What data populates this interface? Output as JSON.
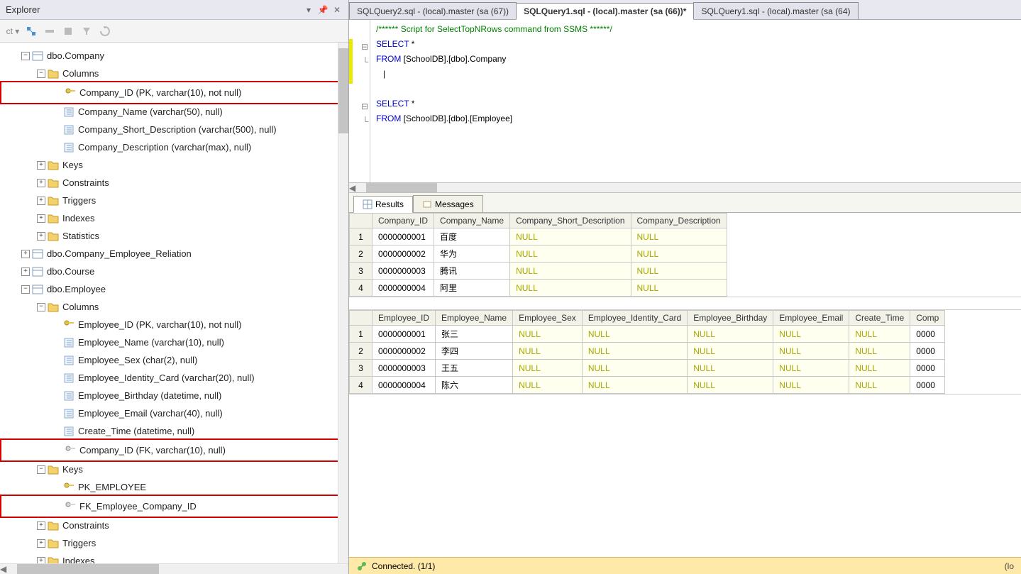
{
  "explorer": {
    "title": "Explorer",
    "tree": {
      "company_table": "dbo.Company",
      "company_columns_folder": "Columns",
      "company_cols": {
        "id": "Company_ID (PK, varchar(10), not null)",
        "name": "Company_Name (varchar(50), null)",
        "short": "Company_Short_Description (varchar(500), null)",
        "desc": "Company_Description (varchar(max), null)"
      },
      "keys": "Keys",
      "constraints": "Constraints",
      "triggers": "Triggers",
      "indexes": "Indexes",
      "statistics": "Statistics",
      "relation": "dbo.Company_Employee_Reliation",
      "course": "dbo.Course",
      "employee_table": "dbo.Employee",
      "employee_columns_folder": "Columns",
      "emp_cols": {
        "id": "Employee_ID (PK, varchar(10), not null)",
        "name": "Employee_Name (varchar(10), null)",
        "sex": "Employee_Sex (char(2), null)",
        "idcard": "Employee_Identity_Card (varchar(20), null)",
        "bday": "Employee_Birthday (datetime, null)",
        "email": "Employee_Email (varchar(40), null)",
        "ctime": "Create_Time (datetime, null)",
        "compid": "Company_ID (FK, varchar(10), null)"
      },
      "emp_keys_folder": "Keys",
      "emp_keys": {
        "pk": "PK_EMPLOYEE",
        "fk": "FK_Employee_Company_ID"
      }
    },
    "toolbar_partial": "ct ▾"
  },
  "tabs": {
    "t1": "SQLQuery2.sql - (local).master (sa (67))",
    "t2": "SQLQuery1.sql - (local).master (sa (66))*",
    "t3": "SQLQuery1.sql - (local).master (sa (64)"
  },
  "sql": {
    "l1_comment": "/****** Script for SelectTopNRows command from SSMS  ******/",
    "l2_select": "SELECT",
    "l2_star": " *",
    "l3_from": "FROM",
    "l3_tbl": " [SchoolDB].[dbo].",
    "l3_tbl2": "Company",
    "l6_select": "SELECT",
    "l6_star": " *",
    "l7_from": "FROM",
    "l7_tbl": " [SchoolDB].[dbo].[Employee]"
  },
  "result_tabs": {
    "results": "Results",
    "messages": "Messages"
  },
  "grid1": {
    "headers": [
      "",
      "Company_ID",
      "Company_Name",
      "Company_Short_Description",
      "Company_Description"
    ],
    "rows": [
      [
        "1",
        "0000000001",
        "百度",
        "NULL",
        "NULL"
      ],
      [
        "2",
        "0000000002",
        "华为",
        "NULL",
        "NULL"
      ],
      [
        "3",
        "0000000003",
        "腾讯",
        "NULL",
        "NULL"
      ],
      [
        "4",
        "0000000004",
        "阿里",
        "NULL",
        "NULL"
      ]
    ]
  },
  "grid2": {
    "headers": [
      "",
      "Employee_ID",
      "Employee_Name",
      "Employee_Sex",
      "Employee_Identity_Card",
      "Employee_Birthday",
      "Employee_Email",
      "Create_Time",
      "Comp"
    ],
    "rows": [
      [
        "1",
        "0000000001",
        "张三",
        "NULL",
        "NULL",
        "NULL",
        "NULL",
        "NULL",
        "0000"
      ],
      [
        "2",
        "0000000002",
        "李四",
        "NULL",
        "NULL",
        "NULL",
        "NULL",
        "NULL",
        "0000"
      ],
      [
        "3",
        "0000000003",
        "王五",
        "NULL",
        "NULL",
        "NULL",
        "NULL",
        "NULL",
        "0000"
      ],
      [
        "4",
        "0000000004",
        "陈六",
        "NULL",
        "NULL",
        "NULL",
        "NULL",
        "NULL",
        "0000"
      ]
    ]
  },
  "status": {
    "text": "Connected. (1/1)",
    "right": "(lo"
  }
}
